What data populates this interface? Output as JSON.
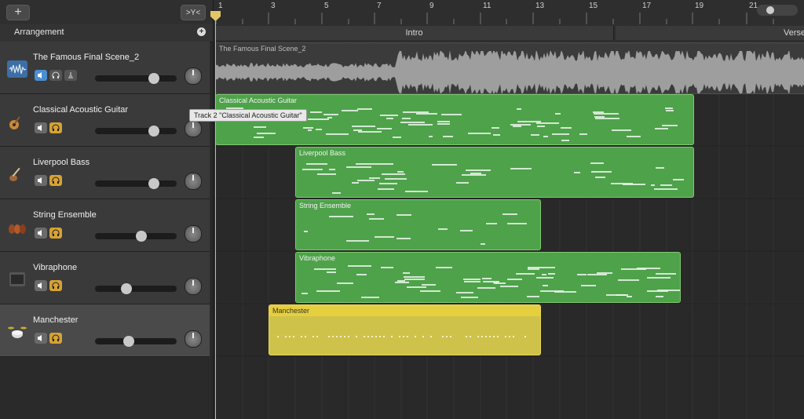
{
  "toolbar": {
    "add_label": "+",
    "filter_label": ">Y<"
  },
  "arrangement": {
    "label": "Arrangement",
    "add_label": "+",
    "sections": [
      "Intro",
      "Verse"
    ]
  },
  "ruler": {
    "bars": [
      "1",
      "3",
      "5",
      "7",
      "9",
      "11",
      "13",
      "15",
      "17",
      "19",
      "21"
    ]
  },
  "tracks": [
    {
      "name": "The Famous Final Scene_2",
      "icon": "waveform-icon",
      "selected": false,
      "volume": 0.72
    },
    {
      "name": "Classical Acoustic Guitar",
      "icon": "acoustic-guitar-icon",
      "selected": false,
      "volume": 0.72
    },
    {
      "name": "Liverpool Bass",
      "icon": "bass-guitar-icon",
      "selected": false,
      "volume": 0.72
    },
    {
      "name": "String Ensemble",
      "icon": "strings-icon",
      "selected": false,
      "volume": 0.58
    },
    {
      "name": "Vibraphone",
      "icon": "amplifier-icon",
      "selected": false,
      "volume": 0.39
    },
    {
      "name": "Manchester",
      "icon": "drum-kit-icon",
      "selected": true,
      "volume": 0.42
    }
  ],
  "regions": {
    "audio": "The Famous Final Scene_2",
    "guitar": "Classical Acoustic Guitar",
    "bass": "Liverpool Bass",
    "strings": "String Ensemble",
    "vibes": "Vibraphone",
    "drums": "Manchester"
  },
  "tooltip": "Track 2 \"Classical Acoustic Guitar\"",
  "colors": {
    "midi_region": "#4ea24a",
    "drummer_region": "#cfc24a",
    "playhead": "#d8c060",
    "accent_blue": "#4a8fd0",
    "accent_yellow": "#d6a233"
  }
}
